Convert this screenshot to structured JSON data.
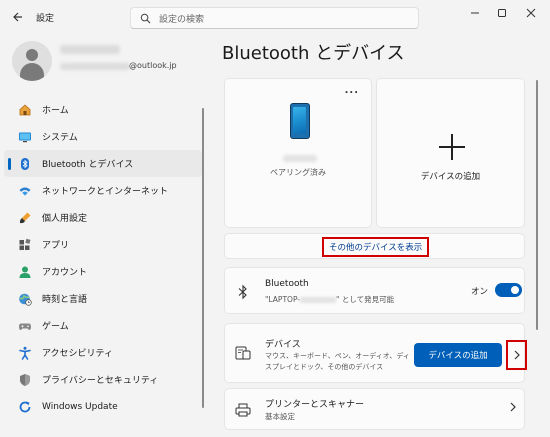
{
  "window": {
    "title": "設定",
    "back_icon": "back-arrow-icon"
  },
  "search": {
    "placeholder": "設定の検索"
  },
  "profile": {
    "email_domain": "@outlook.jp"
  },
  "sidebar": {
    "items": [
      {
        "label": "ホーム",
        "icon": "home-icon"
      },
      {
        "label": "システム",
        "icon": "system-icon"
      },
      {
        "label": "Bluetooth とデバイス",
        "icon": "bluetooth-icon",
        "active": true
      },
      {
        "label": "ネットワークとインターネット",
        "icon": "wifi-icon"
      },
      {
        "label": "個人用設定",
        "icon": "brush-icon"
      },
      {
        "label": "アプリ",
        "icon": "apps-icon"
      },
      {
        "label": "アカウント",
        "icon": "account-icon"
      },
      {
        "label": "時刻と言語",
        "icon": "globe-clock-icon"
      },
      {
        "label": "ゲーム",
        "icon": "gamepad-icon"
      },
      {
        "label": "アクセシビリティ",
        "icon": "accessibility-icon"
      },
      {
        "label": "プライバシーとセキュリティ",
        "icon": "shield-icon"
      },
      {
        "label": "Windows Update",
        "icon": "update-icon"
      }
    ]
  },
  "main": {
    "title": "Bluetooth とデバイス",
    "device_tile": {
      "status": "ペアリング済み",
      "more": "..."
    },
    "add_device_tile": {
      "label": "デバイスの追加"
    },
    "show_more_link": "その他のデバイスを表示",
    "bluetooth": {
      "title": "Bluetooth",
      "sub_prefix": "\"LAPTOP-",
      "sub_suffix": "\" として発見可能",
      "state": "オン"
    },
    "devices": {
      "title": "デバイス",
      "description": "マウス、キーボード、ペン、オーディオ、ディスプレイとドック、その他のデバイス",
      "add_button": "デバイスの追加"
    },
    "printers": {
      "title": "プリンターとスキャナー",
      "subtitle": "基本設定"
    }
  },
  "colors": {
    "accent": "#005fb8",
    "highlight_border": "#d00000",
    "link": "#003e92"
  }
}
